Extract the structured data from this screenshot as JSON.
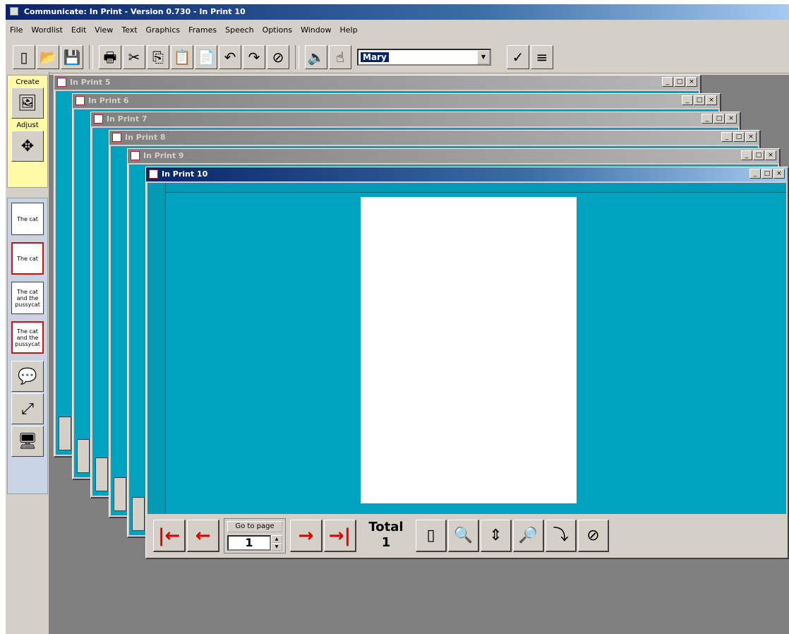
{
  "app": {
    "title": "Communicate: In Print - Version 0.730 - In Print 10"
  },
  "menu": [
    "File",
    "Wordlist",
    "Edit",
    "View",
    "Text",
    "Graphics",
    "Frames",
    "Speech",
    "Options",
    "Window",
    "Help"
  ],
  "toolbar": {
    "voice_select_value": "Mary",
    "buttons": [
      {
        "name": "new-document-icon",
        "glyph": "▯"
      },
      {
        "name": "open-folder-icon",
        "glyph": "📂"
      },
      {
        "name": "save-icon",
        "glyph": "💾"
      },
      {
        "name": "print-icon",
        "glyph": "🖶"
      },
      {
        "name": "cut-icon",
        "glyph": "✂"
      },
      {
        "name": "copy-icon",
        "glyph": "⎘"
      },
      {
        "name": "paste-icon",
        "glyph": "📋"
      },
      {
        "name": "paste-special-icon",
        "glyph": "📄"
      },
      {
        "name": "undo-icon",
        "glyph": "↶"
      },
      {
        "name": "redo-icon",
        "glyph": "↷"
      },
      {
        "name": "delete-frame-icon",
        "glyph": "⊘"
      }
    ],
    "speech_buttons": [
      {
        "name": "speaker-icon",
        "glyph": "🔈"
      },
      {
        "name": "speak-pointer-icon",
        "glyph": "☝"
      }
    ],
    "right_buttons": [
      {
        "name": "spellcheck-icon",
        "glyph": "✓"
      },
      {
        "name": "predict-icon",
        "glyph": "≡"
      }
    ]
  },
  "left_panel": {
    "group_label_top": "Create",
    "group_label_mid": "Adjust",
    "cards": [
      {
        "text": "The cat",
        "red": false
      },
      {
        "text": "The cat",
        "red": true
      },
      {
        "text": "The cat and the pussycat",
        "red": false
      },
      {
        "text": "The cat and the pussycat",
        "red": true
      }
    ]
  },
  "windows": [
    {
      "title": "In Print 5"
    },
    {
      "title": "In Print 6"
    },
    {
      "title": "In Print 7"
    },
    {
      "title": "In Print 8"
    },
    {
      "title": "In Print 9"
    },
    {
      "title": "In Print 10"
    }
  ],
  "page_nav": {
    "goto_label": "Go to page",
    "goto_value": "1",
    "total_label": "Total",
    "total_value": "1"
  }
}
